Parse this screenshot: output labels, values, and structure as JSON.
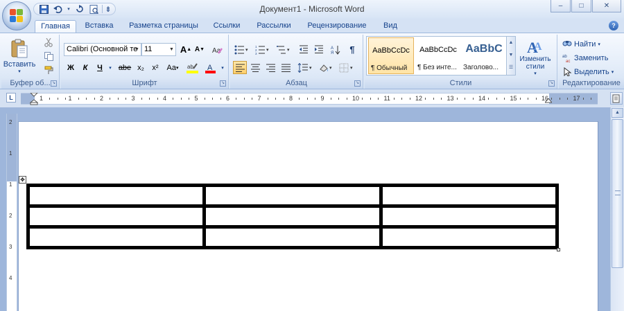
{
  "window": {
    "title": "Документ1 - Microsoft Word",
    "controls": [
      "–",
      "□",
      "✕"
    ]
  },
  "quick_access": {
    "save_icon": "save-icon",
    "undo_icon": "undo-icon",
    "redo_icon": "redo-icon",
    "print_preview_icon": "print-preview-icon",
    "more": "⇟"
  },
  "tabs": [
    {
      "label": "Главная",
      "active": true
    },
    {
      "label": "Вставка"
    },
    {
      "label": "Разметка страницы"
    },
    {
      "label": "Ссылки"
    },
    {
      "label": "Рассылки"
    },
    {
      "label": "Рецензирование"
    },
    {
      "label": "Вид"
    }
  ],
  "ribbon": {
    "clipboard": {
      "paste_label": "Вставить",
      "group_label": "Буфер об..."
    },
    "font": {
      "font_name": "Calibri (Основной те",
      "font_size": "11",
      "bold": "Ж",
      "italic": "К",
      "underline": "Ч",
      "strike": "abe",
      "subscript": "x₂",
      "superscript": "x²",
      "change_case": "Aa",
      "grow": "A",
      "shrink": "A",
      "group_label": "Шрифт"
    },
    "paragraph": {
      "group_label": "Абзац",
      "show_marks": "¶"
    },
    "styles": {
      "group_label": "Стили",
      "tiles": [
        {
          "preview": "AaBbCcDc",
          "name": "¶ Обычный",
          "selected": true
        },
        {
          "preview": "AaBbCcDc",
          "name": "¶ Без инте..."
        },
        {
          "preview": "AaBbC",
          "name": "Заголово..."
        }
      ],
      "change_styles": "Изменить стили"
    },
    "editing": {
      "find": "Найти",
      "replace": "Заменить",
      "select": "Выделить",
      "group_label": "Редактирование"
    }
  },
  "ruler": {
    "tab_selector": "L",
    "numbers": [
      "1",
      "1",
      "2",
      "3",
      "4",
      "5",
      "6",
      "7",
      "8",
      "9",
      "10",
      "11",
      "12",
      "13",
      "14",
      "15",
      "16",
      "17"
    ],
    "vertical_numbers": [
      "2",
      "1",
      "1",
      "2",
      "3",
      "4"
    ]
  },
  "document": {
    "table": {
      "rows": 3,
      "cols": 3
    }
  },
  "colors": {
    "accent": "#15428b",
    "ribbon_bg": "#dfe9f5",
    "workspace": "#9eb6db",
    "highlight": "#ffff00",
    "font_color": "#ff0000"
  }
}
